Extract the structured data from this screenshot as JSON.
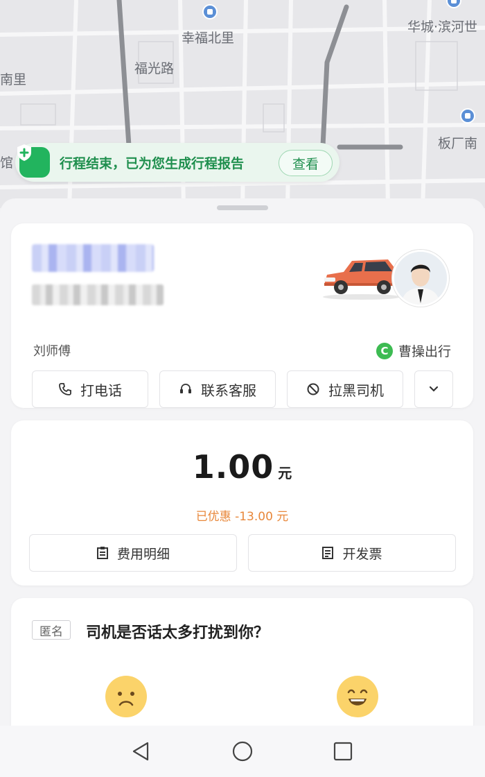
{
  "map": {
    "labels": [
      "幸福北里",
      "福光路",
      "南里",
      "华城·滨河世",
      "板厂南",
      "馆"
    ]
  },
  "banner": {
    "text": "行程结束，已为您生成行程报告",
    "view_label": "查看"
  },
  "driver": {
    "name": "刘师傅",
    "platform": "曹操出行",
    "platform_logo_letter": "C",
    "actions": [
      "打电话",
      "联系客服",
      "拉黑司机"
    ]
  },
  "fare": {
    "amount": "1.00",
    "unit": "元",
    "discount": "已优惠 -13.00 元",
    "detail_label": "费用明细",
    "invoice_label": "开发票"
  },
  "feedback": {
    "tag": "匿名",
    "question": "司机是否话太多打扰到你？"
  },
  "colors": {
    "accent_green": "#22b45e",
    "discount_orange": "#e8873a",
    "platform_green": "#3dbb52"
  }
}
